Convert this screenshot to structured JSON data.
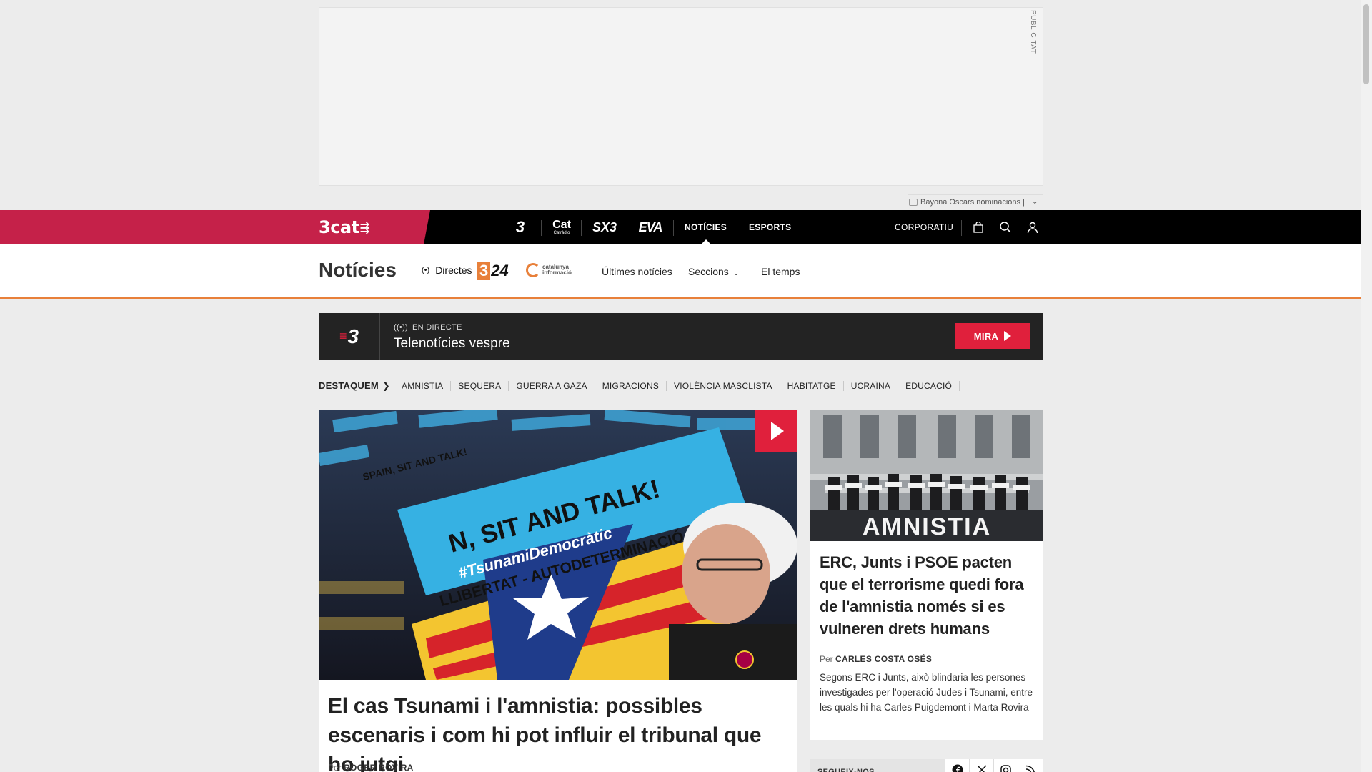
{
  "advertisement": {
    "label": "PUBLICITAT",
    "ticker_text": "Bayona Oscars nominacions |"
  },
  "topnav": {
    "brand": "3cat",
    "channels": [
      {
        "name": "3",
        "icon": "tv3-logo-icon"
      },
      {
        "name": "Cat",
        "sub": "Catràdio",
        "icon": "catradio-logo-icon"
      },
      {
        "name": "SX3",
        "icon": "sx3-logo-icon"
      },
      {
        "name": "EVA",
        "icon": "eva-logo-icon"
      }
    ],
    "noticies": "NOTÍCIES",
    "esports": "ESPORTS",
    "corporatiu": "CORPORATIU",
    "icons": [
      "shop-bag-icon",
      "search-icon",
      "user-icon"
    ],
    "brand_color": "#c52149"
  },
  "section": {
    "title": "Notícies",
    "directes": "Directes",
    "logo_324": "24",
    "logo_324_three": "3",
    "catinfo_line1": "catalunya",
    "catinfo_line2": "informació",
    "ultimes": "Últimes notícies",
    "seccions": "Seccions",
    "temps": "El temps",
    "accent_color": "#e8803a"
  },
  "live": {
    "logo": "3",
    "tag": "EN DIRECTE",
    "title": "Telenotícies vespre",
    "watch_label": "MIRA",
    "accent_color": "#e0203c"
  },
  "destaquem": {
    "label": "DESTAQUEM",
    "tags": [
      "AMNISTIA",
      "SEQUERA",
      "GUERRA A GAZA",
      "MIGRACIONS",
      "VIOLÈNCIA MASCLISTA",
      "HABITATGE",
      "UCRAÏNA",
      "EDUCACIÓ"
    ]
  },
  "main_article": {
    "title": "El cas Tsunami i l'amnistia: possibles escenaris i com hi pot influir el tribunal que ho jutgi",
    "byline_prefix": "Per",
    "author": "ROGER ROVIRA",
    "image_banner_line1": "N, SIT AND TALK!",
    "image_banner_line2": "#TsunamiDemocràtic",
    "image_banner_line3": "LLIBERTAT - AUTODETERMINACIÓ",
    "image_back_banner": "SPAIN, SIT AND TALK!"
  },
  "side_article": {
    "image_text": "AMNISTIA",
    "title": "ERC, Junts i PSOE pacten que el terrorisme quedi fora de l'amnistia només si es vulneren drets humans",
    "byline_prefix": "Per",
    "author": "CARLES COSTA OSÉS",
    "summary": "Segons ERC i Junts, això blindaria les persones investigades per l'operació Judes i Tsunami, entre les quals hi ha Carles Puigdemont i Marta Rovira"
  },
  "follow": {
    "label": "SEGUEIX-NOS",
    "networks": [
      "facebook-icon",
      "x-twitter-icon",
      "instagram-icon",
      "rss-icon"
    ]
  }
}
